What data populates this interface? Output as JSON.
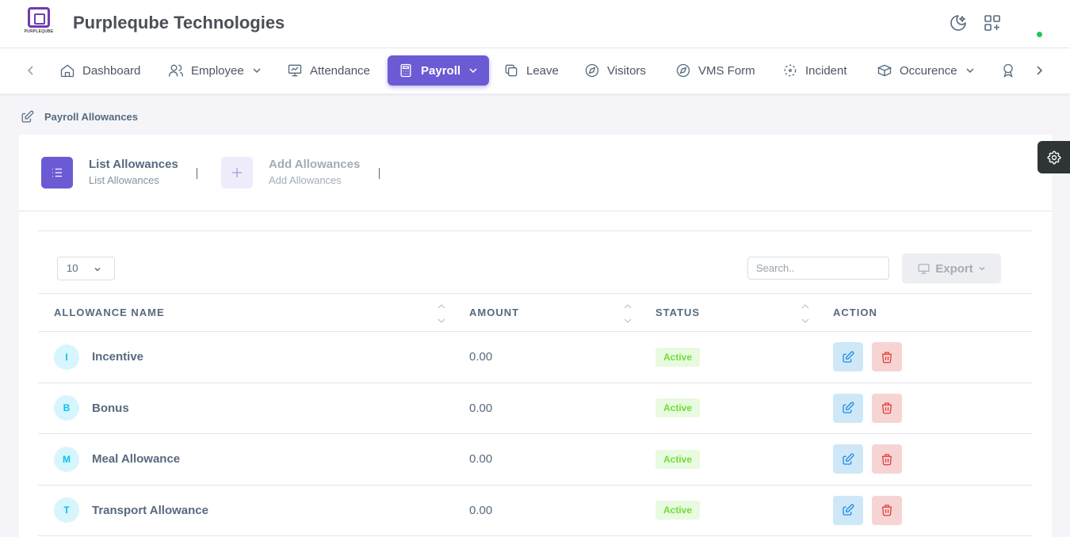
{
  "header": {
    "logo_text": "PURPLEQUBE",
    "company": "Purpleqube Technologies"
  },
  "nav": {
    "items": [
      {
        "label": "Dashboard",
        "icon": "home-icon"
      },
      {
        "label": "Employee",
        "icon": "users-icon",
        "dropdown": true
      },
      {
        "label": "Attendance",
        "icon": "presentation-icon"
      },
      {
        "label": "Payroll",
        "icon": "calculator-icon",
        "dropdown": true,
        "active": true
      },
      {
        "label": "Leave",
        "icon": "copy-icon"
      },
      {
        "label": "Visitors",
        "icon": "compass-icon"
      },
      {
        "label": "VMS Form",
        "icon": "compass-icon"
      },
      {
        "label": "Incident",
        "icon": "focus-icon"
      },
      {
        "label": "Occurence",
        "icon": "box-icon",
        "dropdown": true
      }
    ]
  },
  "breadcrumb": "Payroll Allowances",
  "wizard": {
    "steps": [
      {
        "title": "List Allowances",
        "subtitle": "List Allowances"
      },
      {
        "title": "Add Allowances",
        "subtitle": "Add Allowances"
      }
    ]
  },
  "table_controls": {
    "page_length": "10",
    "search_placeholder": "Search..",
    "export_label": "Export"
  },
  "table": {
    "headers": [
      "ALLOWANCE NAME",
      "AMOUNT",
      "STATUS",
      "ACTION"
    ],
    "rows": [
      {
        "initial": "I",
        "name": "Incentive",
        "amount": "0.00",
        "status": "Active"
      },
      {
        "initial": "B",
        "name": "Bonus",
        "amount": "0.00",
        "status": "Active"
      },
      {
        "initial": "M",
        "name": "Meal Allowance",
        "amount": "0.00",
        "status": "Active"
      },
      {
        "initial": "T",
        "name": "Transport Allowance",
        "amount": "0.00",
        "status": "Active"
      }
    ]
  },
  "colors": {
    "accent": "#6a5bd5",
    "status_active": "#71dd37",
    "avatar": "#03c3ec",
    "danger": "#ff3e1d"
  }
}
